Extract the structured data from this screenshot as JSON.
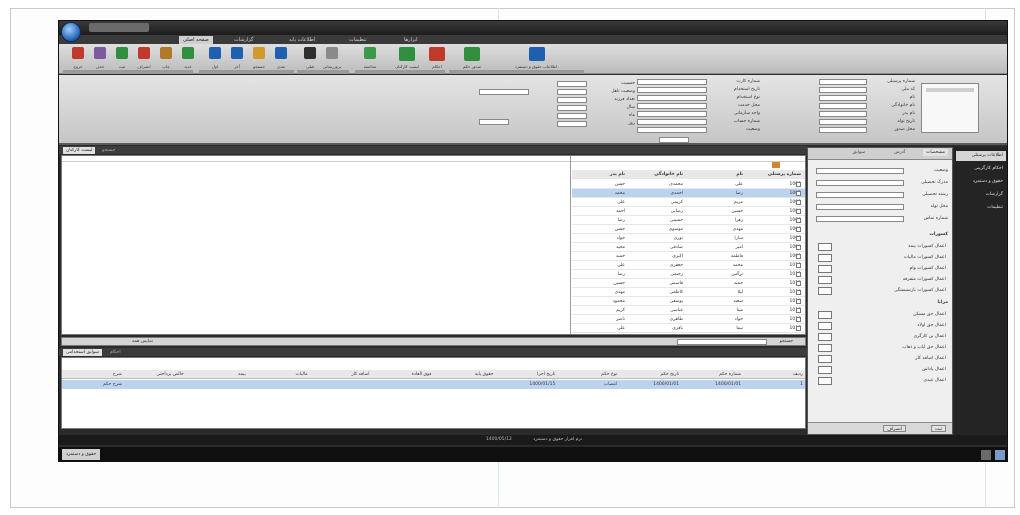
{
  "app": {
    "title": "",
    "ribbon_tabs": [
      "صفحه اصلی",
      "گزارشات",
      "اطلاعات پایه",
      "تنظیمات",
      "ابزارها"
    ],
    "ribbon_buttons": [
      {
        "label": "خروج",
        "color": "#c0392b"
      },
      {
        "label": "حذف",
        "color": "#7d5a9e"
      },
      {
        "label": "ثبت",
        "color": "#2f8f3f"
      },
      {
        "label": "انصراف",
        "color": "#c0392b"
      },
      {
        "label": "چاپ",
        "color": "#b07a2a"
      },
      {
        "label": "جدید",
        "color": "#2f8f3f"
      },
      {
        "label": "اول",
        "color": "#1f5fb0"
      },
      {
        "label": "آخر",
        "color": "#1f5fb0"
      },
      {
        "label": "جستجو",
        "color": "#d29a2a"
      },
      {
        "label": "بعدی",
        "color": "#1f5fb0"
      },
      {
        "label": "قبلی",
        "color": "#2e2e2e"
      },
      {
        "label": "بروزرسانی",
        "color": "#8a8a8a"
      },
      {
        "label": "محاسبه",
        "color": "#3a9a4a"
      },
      {
        "label": "لیست کارکنان",
        "color": "#2f8f3f"
      },
      {
        "label": "احکام",
        "color": "#c0392b"
      },
      {
        "label": "صدور حکم",
        "color": "#2f8f3f"
      },
      {
        "label": "ثبت اطلاعات حقوق و دستمزد",
        "color": "#1f5fb0"
      }
    ]
  },
  "form": {
    "labels_right": [
      "شماره پرسنلی",
      "کد ملی",
      "نام",
      "نام خانوادگی",
      "نام پدر",
      "تاریخ تولد",
      "محل صدور"
    ],
    "labels_mid": [
      "شماره کارت",
      "تاریخ استخدام",
      "نوع استخدام",
      "محل خدمت",
      "واحد سازمانی",
      "شماره حساب",
      "وضعیت"
    ],
    "labels_left": [
      "جنسیت",
      "وضعیت تاهل",
      "تعداد فرزند",
      "سال",
      "ماه",
      "روز"
    ],
    "fields_right": [
      "",
      "",
      "",
      "",
      "",
      "",
      ""
    ],
    "fields_mid": [
      "",
      "",
      "",
      "",
      "",
      "",
      ""
    ],
    "fields_left": [
      "",
      "",
      "",
      "",
      "",
      ""
    ]
  },
  "top_pane": {
    "tabs": [
      "لیست کارکنان",
      "جستجو"
    ],
    "columns": [
      "شماره پرسنلی",
      "نام",
      "نام خانوادگی",
      "نام پدر"
    ],
    "rows": [
      [
        "1001",
        "علی",
        "محمدی",
        "حسن"
      ],
      [
        "1002",
        "رضا",
        "احمدی",
        "محمد"
      ],
      [
        "1003",
        "مریم",
        "کریمی",
        "علی"
      ],
      [
        "1004",
        "حسین",
        "رضایی",
        "احمد"
      ],
      [
        "1005",
        "زهرا",
        "حسینی",
        "رضا"
      ],
      [
        "1006",
        "مهدی",
        "موسوی",
        "حسن"
      ],
      [
        "1007",
        "سارا",
        "نوری",
        "جواد"
      ],
      [
        "1008",
        "امیر",
        "صادقی",
        "مجید"
      ],
      [
        "1009",
        "فاطمه",
        "اکبری",
        "حمید"
      ],
      [
        "1010",
        "محمد",
        "جعفری",
        "علی"
      ],
      [
        "1011",
        "نرگس",
        "رحیمی",
        "رضا"
      ],
      [
        "1012",
        "حمید",
        "قاسمی",
        "حسین"
      ],
      [
        "1013",
        "لیلا",
        "کاظمی",
        "مهدی"
      ],
      [
        "1014",
        "سعید",
        "یوسفی",
        "محمود"
      ],
      [
        "1015",
        "مینا",
        "عباسی",
        "کریم"
      ],
      [
        "1016",
        "جواد",
        "طاهری",
        "ناصر"
      ],
      [
        "1017",
        "نیما",
        "باقری",
        "علی"
      ]
    ],
    "filter_label": "جستجو",
    "filter_text": "نمایش همه"
  },
  "bottom_pane": {
    "tabs": [
      "سوابق استخدامی",
      "احکام"
    ],
    "columns": [
      "ردیف",
      "شماره حکم",
      "تاریخ حکم",
      "نوع حکم",
      "تاریخ اجرا",
      "حقوق پایه",
      "فوق العاده",
      "اضافه کار",
      "مالیات",
      "بیمه",
      "خالص پرداختی",
      "شرح"
    ],
    "row": [
      "1",
      "1400/01/01",
      "1400/01/01",
      "انتصاب",
      "1400/01/15",
      "",
      "",
      "",
      "",
      "",
      "",
      "شرح حکم"
    ]
  },
  "side_panel": {
    "tabs": [
      "مشخصات",
      "آدرس",
      "سوابق"
    ],
    "fields": [
      "وضعیت",
      "مدرک تحصیلی",
      "رشته تحصیلی",
      "محل تولد",
      "شماره تماس"
    ],
    "section1": "کسورات",
    "checks1": [
      "اعمال کسورات بیمه",
      "اعمال کسورات مالیات",
      "اعمال کسورات وام",
      "اعمال کسورات متفرقه",
      "اعمال کسورات بازنشستگی"
    ],
    "section2": "مزایا",
    "checks2": [
      "اعمال حق مسکن",
      "اعمال حق اولاد",
      "اعمال بن کارگری",
      "اعمال حق ایاب و ذهاب",
      "اعمال اضافه کار",
      "اعمال پاداش",
      "اعمال عیدی"
    ],
    "footer": [
      "ثبت",
      "انصراف"
    ]
  },
  "nav": {
    "items": [
      "اطلاعات پرسنلی",
      "احکام کارگزینی",
      "حقوق و دستمزد",
      "گزارشات",
      "تنظیمات"
    ]
  },
  "status": {
    "center": "1400/05/12",
    "text": "نرم افزار حقوق و دستمزد"
  },
  "taskbar": {
    "button": "حقوق و دستمزد"
  }
}
